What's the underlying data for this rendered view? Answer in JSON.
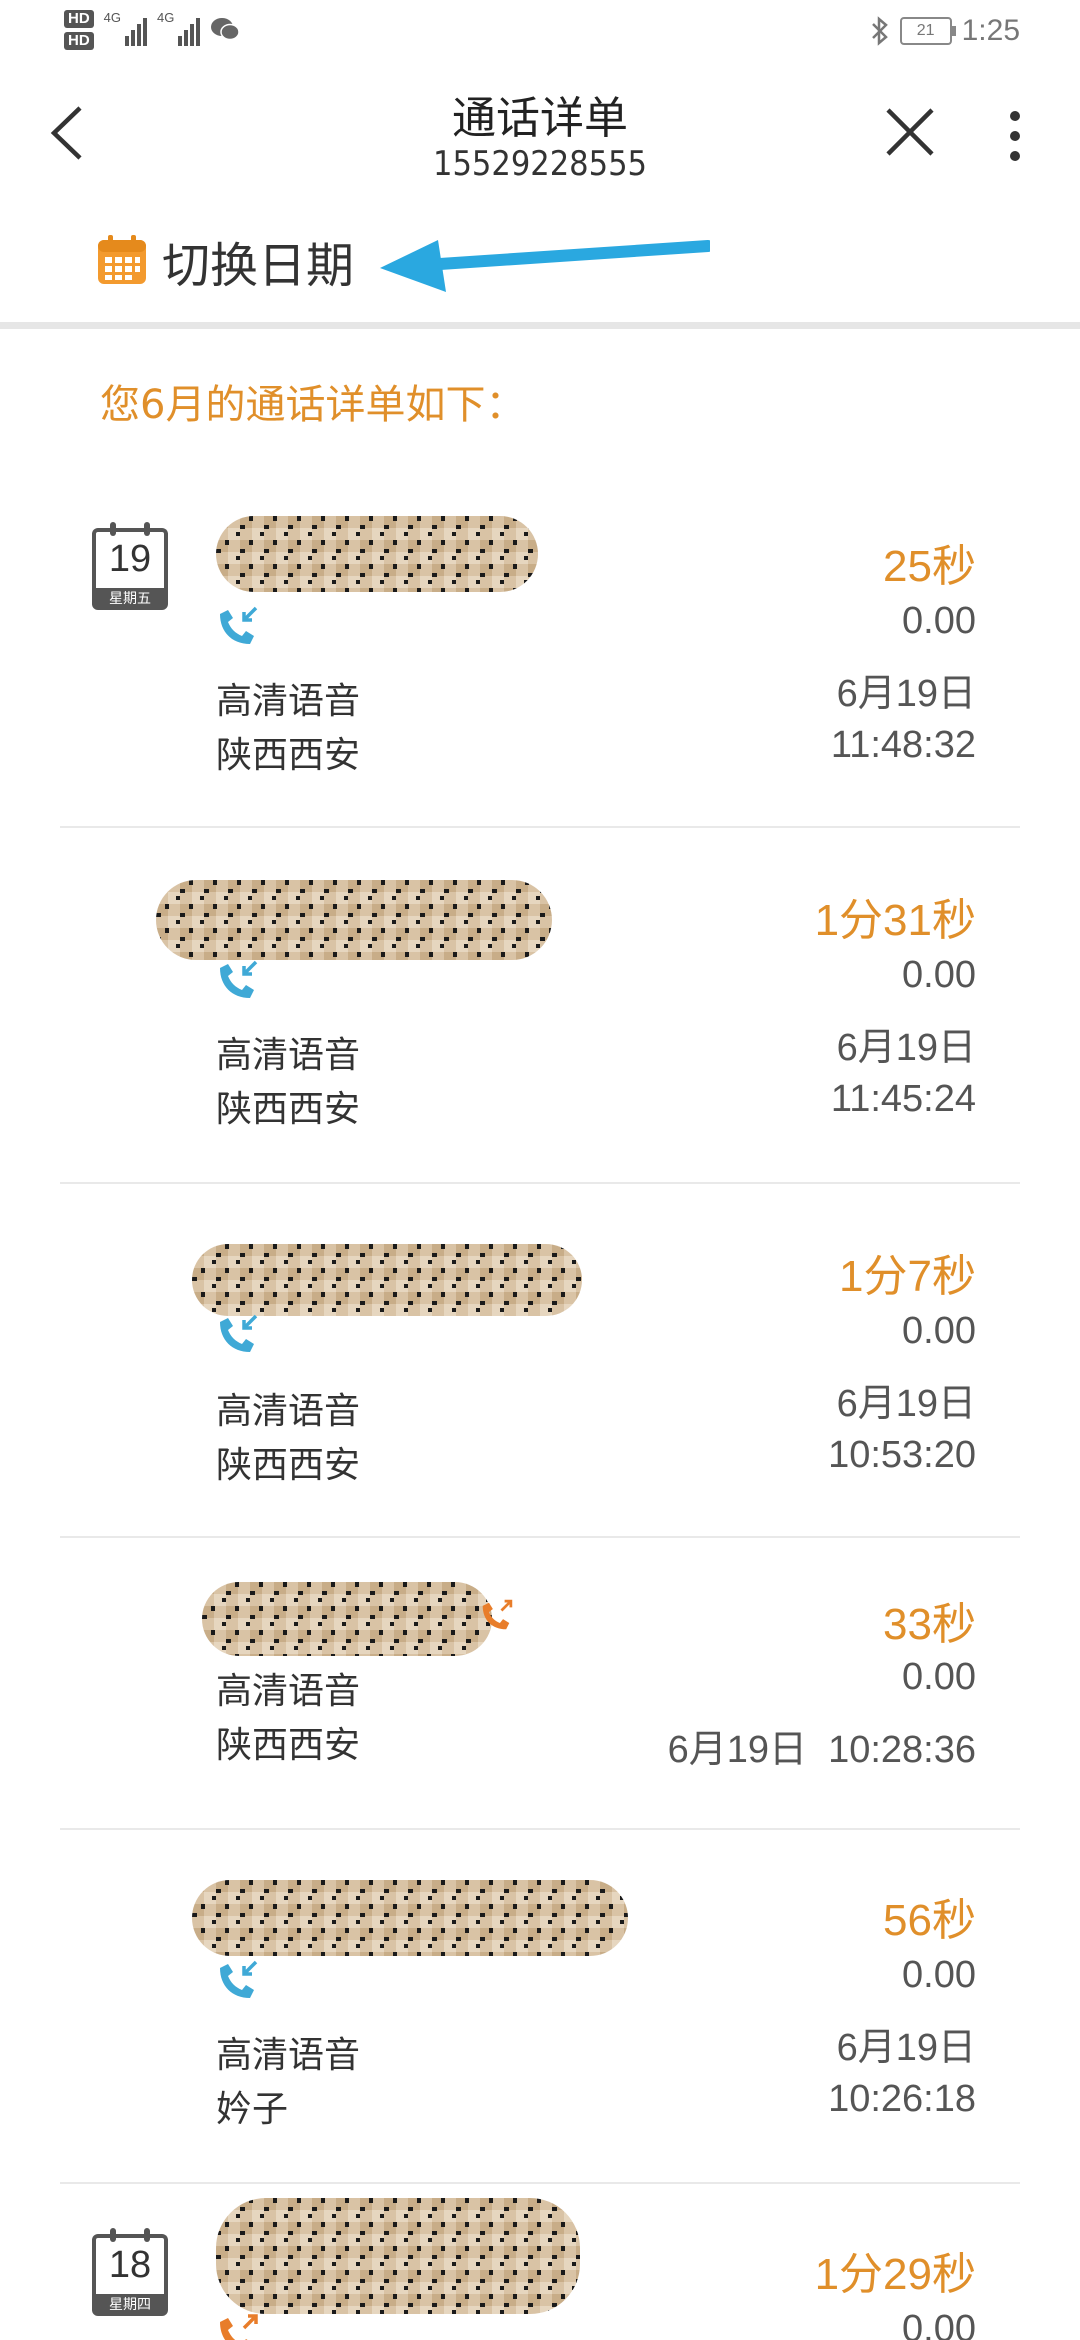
{
  "status_bar": {
    "hd1": "HD",
    "hd2": "HD",
    "net1": "4G",
    "net2": "4G",
    "battery": "21",
    "time": "1:25"
  },
  "header": {
    "title": "通话详单",
    "phone": "15529228555"
  },
  "date_switch": {
    "label": "切换日期"
  },
  "intro": "您6月的通话详单如下：",
  "colors": {
    "accent": "#e08f2a",
    "call_icon": "#3fa9d6",
    "outgoing_icon": "#e87d2a"
  },
  "records": [
    {
      "badge_day": "19",
      "badge_week": "星期五",
      "direction": "incoming",
      "type": "高清语音",
      "location": "陕西西安",
      "duration": "25秒",
      "fee": "0.00",
      "date": "6月19日",
      "time": "11:48:32"
    },
    {
      "direction": "incoming",
      "type": "高清语音",
      "location": "陕西西安",
      "duration": "1分31秒",
      "fee": "0.00",
      "date": "6月19日",
      "time": "11:45:24"
    },
    {
      "direction": "incoming",
      "type": "高清语音",
      "location": "陕西西安",
      "duration": "1分7秒",
      "fee": "0.00",
      "date": "6月19日",
      "time": "10:53:20"
    },
    {
      "direction": "outgoing",
      "type": "高清语音",
      "location": "陕西西安",
      "duration": "33秒",
      "fee": "0.00",
      "datetime": "6月19日  10:28:36"
    },
    {
      "direction": "incoming",
      "type": "高清语音",
      "location": "妗子",
      "duration": "56秒",
      "fee": "0.00",
      "date": "6月19日",
      "time": "10:26:18"
    },
    {
      "badge_day": "18",
      "badge_week": "星期四",
      "direction": "outgoing",
      "duration": "1分29秒",
      "fee": "0.00"
    }
  ]
}
